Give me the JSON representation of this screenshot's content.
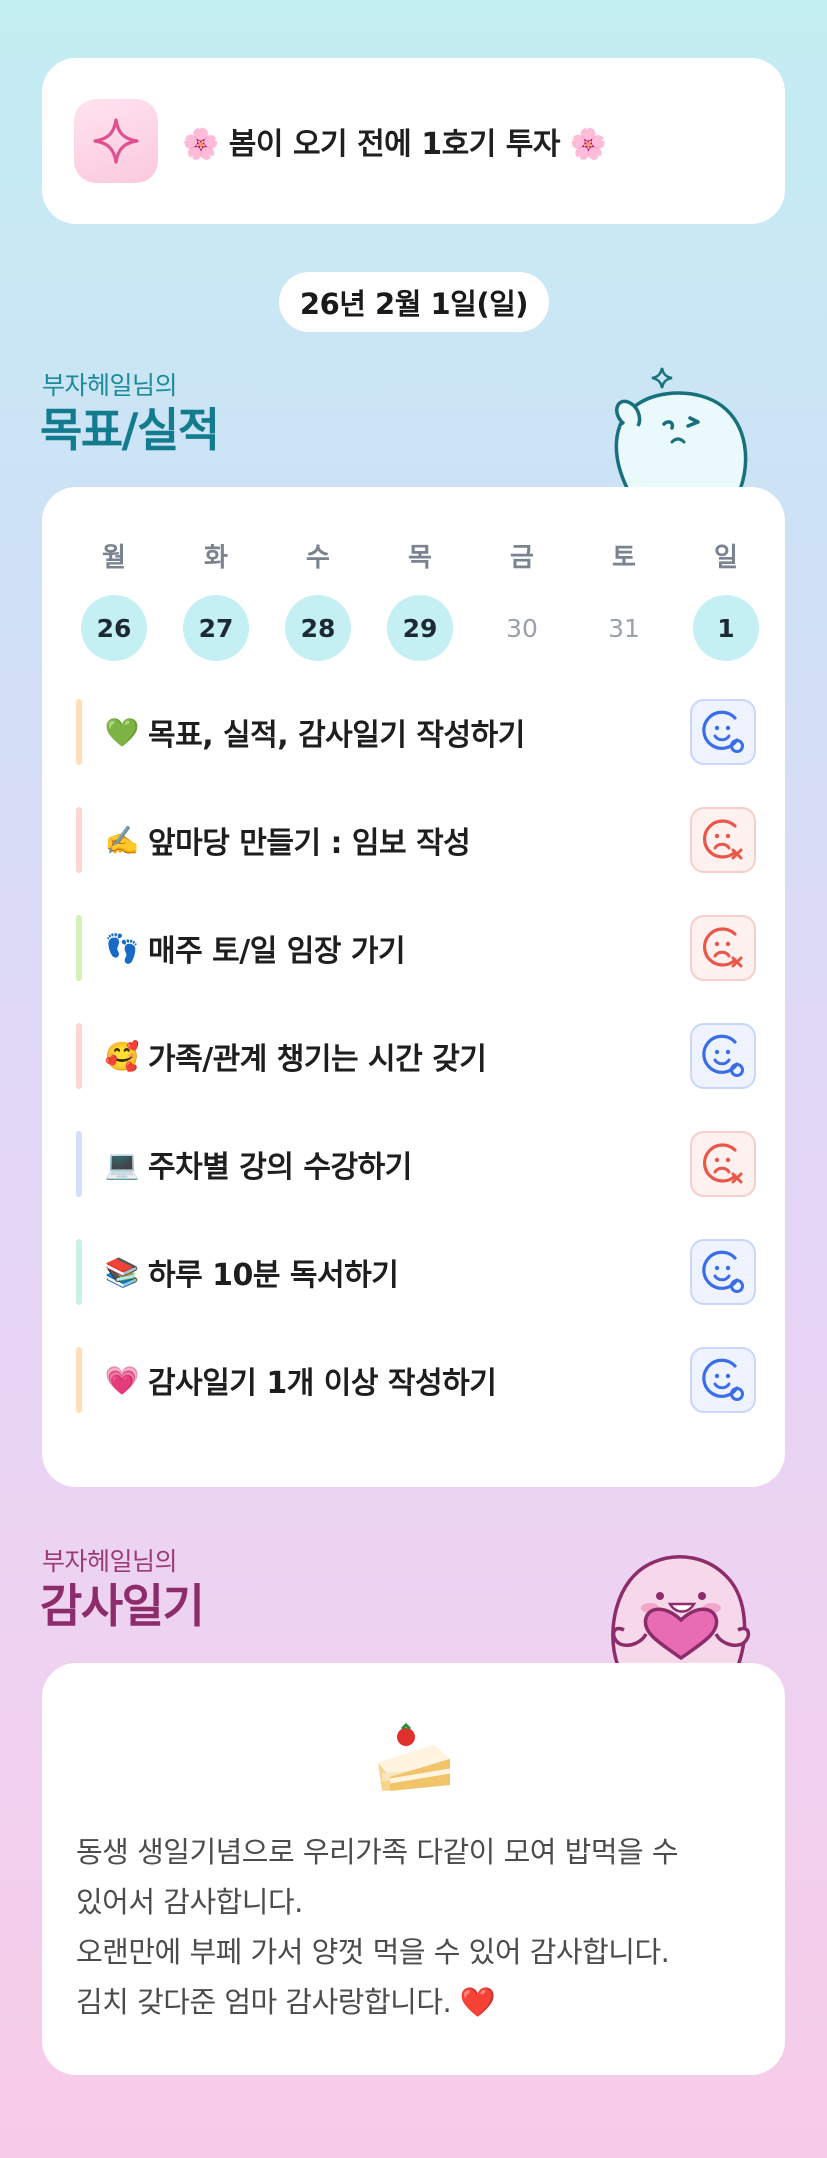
{
  "header": {
    "icon": "sparkle-icon",
    "title": "🌸 봄이 오기 전에 1호기 투자 🌸"
  },
  "date": "26년 2월 1일(일)",
  "goals_section": {
    "subtitle": "부자헤일님의",
    "title": "목표/실적"
  },
  "week": {
    "days": [
      "월",
      "화",
      "수",
      "목",
      "금",
      "토",
      "일"
    ],
    "dates": [
      {
        "label": "26",
        "active": true
      },
      {
        "label": "27",
        "active": true
      },
      {
        "label": "28",
        "active": true
      },
      {
        "label": "29",
        "active": true
      },
      {
        "label": "30",
        "active": false
      },
      {
        "label": "31",
        "active": false
      },
      {
        "label": "1",
        "active": true
      }
    ]
  },
  "goals": [
    {
      "emoji": "💚",
      "text": "목표, 실적, 감사일기 작성하기",
      "status": "done",
      "bar_color": "#fde0b8"
    },
    {
      "emoji": "✍️",
      "text": "앞마당 만들기 : 임보 작성",
      "status": "missed",
      "bar_color": "#fcd6d2"
    },
    {
      "emoji": "👣",
      "text": "매주 토/일 임장 가기",
      "status": "missed",
      "bar_color": "#d4f2b8"
    },
    {
      "emoji": "🥰",
      "text": "가족/관계 챙기는 시간 갖기",
      "status": "done",
      "bar_color": "#fcd6d2"
    },
    {
      "emoji": "💻",
      "text": "주차별 강의 수강하기",
      "status": "missed",
      "bar_color": "#d6dffa"
    },
    {
      "emoji": "📚",
      "text": "하루 10분 독서하기",
      "status": "done",
      "bar_color": "#c9f2e2"
    },
    {
      "emoji": "💗",
      "text": "감사일기 1개 이상 작성하기",
      "status": "done",
      "bar_color": "#fde0b8"
    }
  ],
  "thanks_section": {
    "subtitle": "부자헤일님의",
    "title": "감사일기",
    "icon": "cake-icon",
    "lines": [
      "동생 생일기념으로 우리가족 다같이 모여 밥먹을 수",
      "있어서 감사합니다.",
      "오랜만에 부페 가서 양껏 먹을 수 있어 감사합니다.",
      "김치 갖다준 엄마 감사랑합니다. ❤️"
    ]
  },
  "colors": {
    "accent_teal": "#127c8e",
    "accent_magenta": "#8d2c6a",
    "status_good": "#3a6ee8",
    "status_bad": "#e8574a"
  }
}
